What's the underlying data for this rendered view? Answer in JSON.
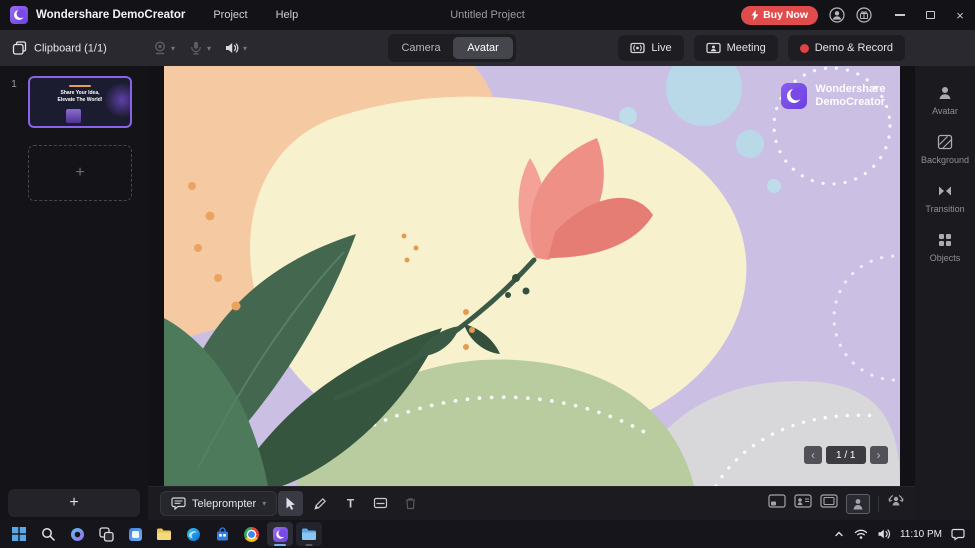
{
  "icons": {
    "caret_down": "▾",
    "plus": "+",
    "chevron_left": "‹",
    "chevron_right": "›",
    "close": "×",
    "text_tool": "T"
  },
  "titlebar": {
    "app_name": "Wondershare DemoCreator",
    "menu_project": "Project",
    "menu_help": "Help",
    "project_title": "Untitled Project",
    "buy_now": "Buy Now"
  },
  "toolbar": {
    "clipboard": "Clipboard (1/1)",
    "tab_camera": "Camera",
    "tab_avatar": "Avatar",
    "live": "Live",
    "meeting": "Meeting",
    "record": "Demo & Record"
  },
  "sidebar": {
    "slide_number": "1",
    "thumb_line1": "Share Your Idea,",
    "thumb_line2": "Elevate The World!"
  },
  "canvas": {
    "watermark_line1": "Wondershare",
    "watermark_line2": "DemoCreator",
    "page_indicator": "1 / 1"
  },
  "right_panel": {
    "items": [
      {
        "label": "Avatar"
      },
      {
        "label": "Background"
      },
      {
        "label": "Transition"
      },
      {
        "label": "Objects"
      }
    ]
  },
  "bottombar": {
    "teleprompter": "Teleprompter"
  },
  "taskbar": {
    "time": "11:10 PM"
  },
  "colors": {
    "accent_purple": "#7c4dff",
    "buy_now_red": "#e04b4b",
    "record_dot_red": "#e04343",
    "canvas_lavender": "#cbc0e4",
    "tulip_coral": "#ef9087",
    "leaf_green": "#44684f"
  }
}
